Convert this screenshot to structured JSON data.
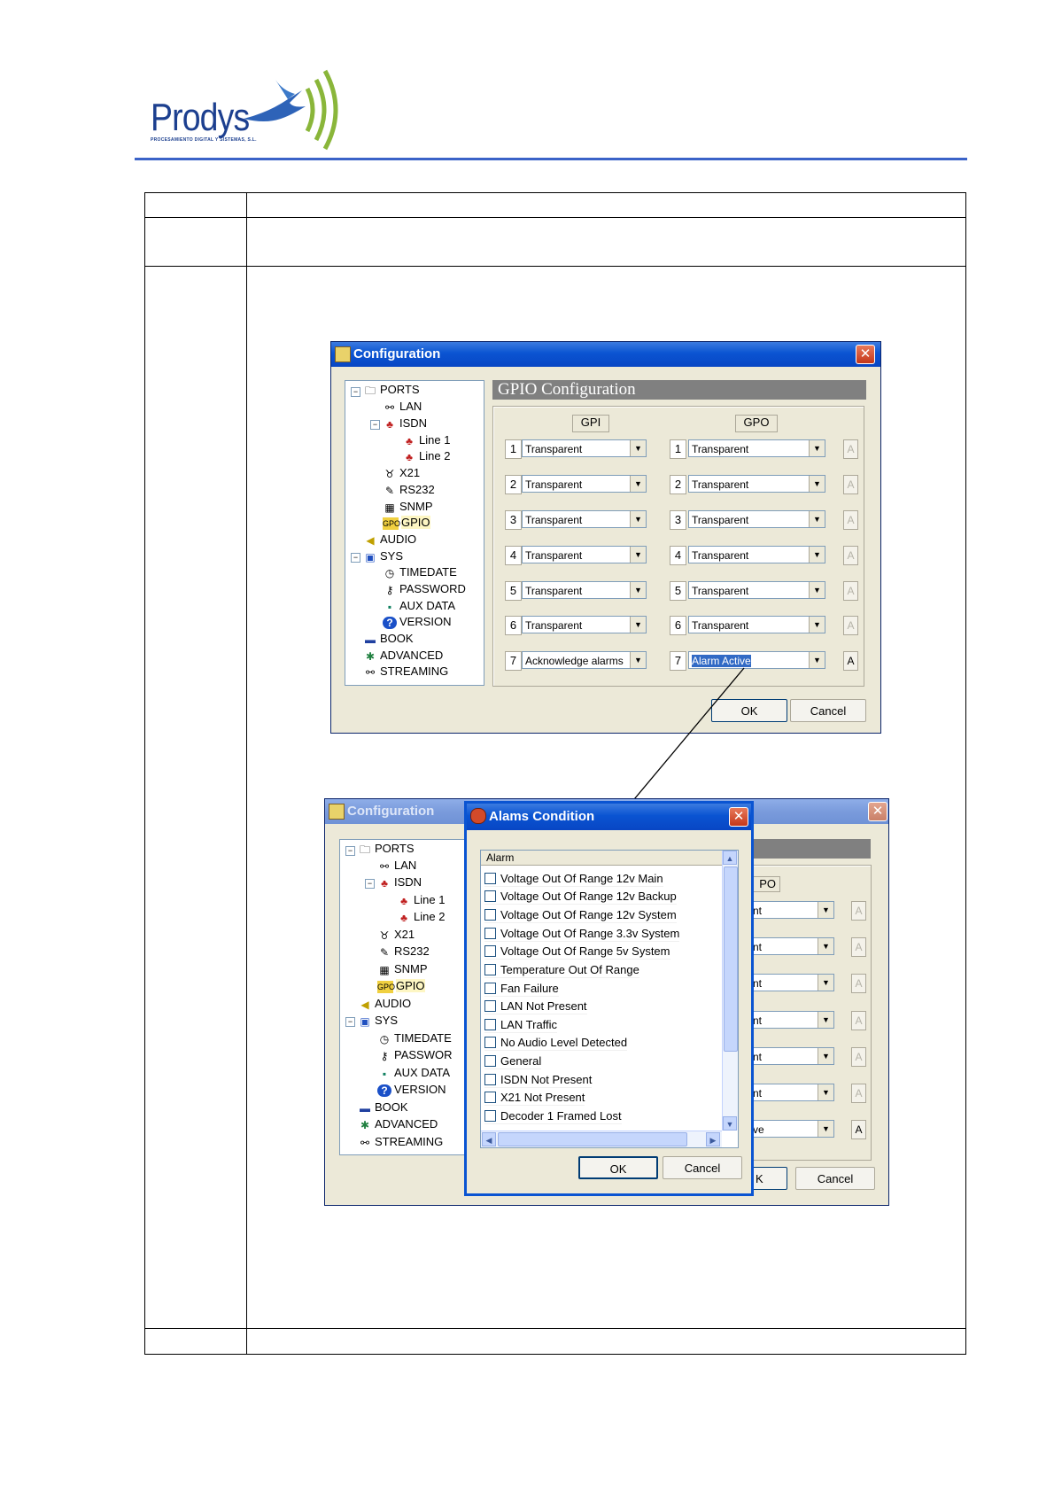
{
  "logo": {
    "name": "Prodys",
    "tagline": "PROCESAMIENTO DIGITAL Y SISTEMAS, S.L."
  },
  "config_window": {
    "title": "Configuration",
    "close_glyph": "✕",
    "panel_title": "GPIO Configuration",
    "gpi_header": "GPI",
    "gpo_header": "GPO",
    "a_label": "A",
    "gpi": [
      {
        "n": "1",
        "value": "Transparent"
      },
      {
        "n": "2",
        "value": "Transparent"
      },
      {
        "n": "3",
        "value": "Transparent"
      },
      {
        "n": "4",
        "value": "Transparent"
      },
      {
        "n": "5",
        "value": "Transparent"
      },
      {
        "n": "6",
        "value": "Transparent"
      },
      {
        "n": "7",
        "value": "Acknowledge alarms"
      }
    ],
    "gpo": [
      {
        "n": "1",
        "value": "Transparent"
      },
      {
        "n": "2",
        "value": "Transparent"
      },
      {
        "n": "3",
        "value": "Transparent"
      },
      {
        "n": "4",
        "value": "Transparent"
      },
      {
        "n": "5",
        "value": "Transparent"
      },
      {
        "n": "6",
        "value": "Transparent"
      },
      {
        "n": "7",
        "value": "Alarm Active"
      }
    ],
    "ok_label": "OK",
    "cancel_label": "Cancel"
  },
  "tree": {
    "ports": "PORTS",
    "lan": "LAN",
    "isdn": "ISDN",
    "line1": "Line 1",
    "line2": "Line 2",
    "x21": "X21",
    "rs232": "RS232",
    "snmp": "SNMP",
    "gpio": "GPIO",
    "audio": "AUDIO",
    "sys": "SYS",
    "timedate": "TIMEDATE",
    "password": "PASSWORD",
    "password_cut": "PASSWOR",
    "auxdata": "AUX DATA",
    "version": "VERSION",
    "book": "BOOK",
    "advanced": "ADVANCED",
    "streaming": "STREAMING",
    "gpio_icon_text": "GPO"
  },
  "back_window": {
    "title": "Configuration",
    "gpo_header_partial": "PO",
    "combo_partials": [
      "nt",
      "nt",
      "nt",
      "nt",
      "nt",
      "nt",
      "ve"
    ],
    "ok_partial": "K",
    "cancel_label": "Cancel"
  },
  "alarms_dialog": {
    "title": "Alams Condition",
    "header": "Alarm",
    "items": [
      "Voltage Out Of Range 12v Main",
      "Voltage Out Of Range 12v Backup",
      "Voltage Out Of Range 12v System",
      "Voltage Out Of Range 3.3v System",
      "Voltage Out Of Range 5v System",
      "Temperature Out Of Range",
      "Fan Failure",
      "LAN Not Present",
      "LAN Traffic",
      "No Audio Level Detected",
      "General",
      "ISDN Not Present",
      "X21 Not Present",
      "Decoder 1 Framed Lost"
    ],
    "ok_label": "OK",
    "cancel_label": "Cancel"
  }
}
